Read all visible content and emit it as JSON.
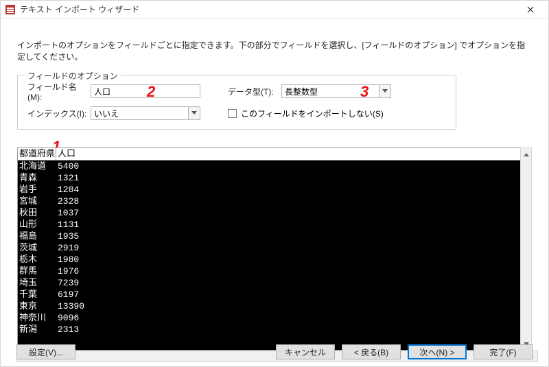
{
  "titlebar": {
    "title": "テキスト インポート ウィザード"
  },
  "instruction": "インポートのオプションをフィールドごとに指定できます。下の部分でフィールドを選択し、[フィールドのオプション] でオプションを指定してください。",
  "options": {
    "legend": "フィールドのオプション",
    "field_name_label": "フィールド名(M):",
    "field_name_value": "人口",
    "data_type_label": "データ型(T):",
    "data_type_value": "長整数型",
    "index_label": "インデックス(I):",
    "index_value": "いいえ",
    "skip_label": "このフィールドをインポートしない(S)",
    "skip_checked": false
  },
  "annotations": {
    "one": "1",
    "two": "2",
    "three": "3"
  },
  "preview": {
    "headers": [
      "都道府県",
      "人口"
    ],
    "rows": [
      {
        "pref": "北海道",
        "pop": "5400"
      },
      {
        "pref": "青森",
        "pop": "1321"
      },
      {
        "pref": "岩手",
        "pop": "1284"
      },
      {
        "pref": "宮城",
        "pop": "2328"
      },
      {
        "pref": "秋田",
        "pop": "1037"
      },
      {
        "pref": "山形",
        "pop": "1131"
      },
      {
        "pref": "福島",
        "pop": "1935"
      },
      {
        "pref": "茨城",
        "pop": "2919"
      },
      {
        "pref": "栃木",
        "pop": "1980"
      },
      {
        "pref": "群馬",
        "pop": "1976"
      },
      {
        "pref": "埼玉",
        "pop": "7239"
      },
      {
        "pref": "千葉",
        "pop": "6197"
      },
      {
        "pref": "東京",
        "pop": "13390"
      },
      {
        "pref": "神奈川",
        "pop": "9096"
      },
      {
        "pref": "新潟",
        "pop": "2313"
      }
    ]
  },
  "buttons": {
    "settings": "設定(V)...",
    "cancel": "キャンセル",
    "back": "< 戻る(B)",
    "next": "次へ(N) >",
    "finish": "完了(F)"
  }
}
